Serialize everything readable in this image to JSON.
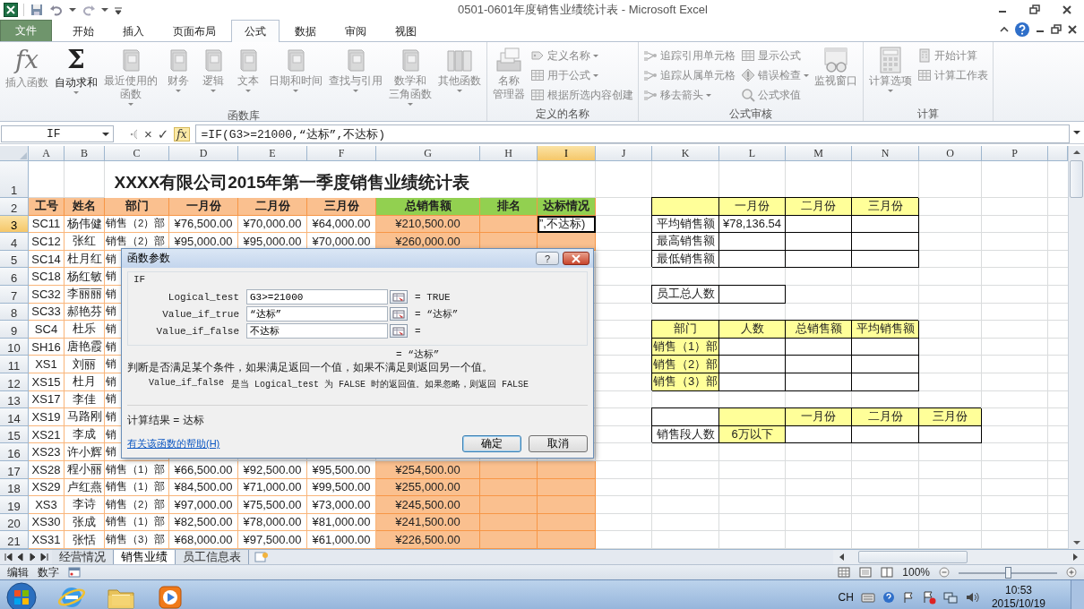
{
  "window": {
    "title": "0501-0601年度销售业绩统计表 - Microsoft Excel"
  },
  "ribbon_tabs": [
    {
      "label": "文件",
      "kind": "file",
      "selected": false
    },
    {
      "label": "开始",
      "kind": "tab",
      "selected": false
    },
    {
      "label": "插入",
      "kind": "tab",
      "selected": false
    },
    {
      "label": "页面布局",
      "kind": "tab",
      "selected": false
    },
    {
      "label": "公式",
      "kind": "tab",
      "selected": true
    },
    {
      "label": "数据",
      "kind": "tab",
      "selected": false
    },
    {
      "label": "审阅",
      "kind": "tab",
      "selected": false
    },
    {
      "label": "视图",
      "kind": "tab",
      "selected": false
    }
  ],
  "ribbon_groups": [
    {
      "label": "函数库",
      "items": [
        {
          "kind": "large",
          "glyph": "fx",
          "label": "插入函数",
          "disabled": true,
          "dropdown": false
        },
        {
          "kind": "large",
          "glyph": "Σ",
          "label": "自动求和",
          "disabled": false,
          "dropdown": true
        },
        {
          "kind": "large",
          "label": [
            "最近使用的",
            "函数"
          ],
          "disabled": true,
          "dropdown": true
        },
        {
          "kind": "large",
          "label": "财务",
          "disabled": true,
          "dropdown": true
        },
        {
          "kind": "large",
          "label": "逻辑",
          "disabled": true,
          "dropdown": true
        },
        {
          "kind": "large",
          "label": "文本",
          "disabled": true,
          "dropdown": true
        },
        {
          "kind": "large",
          "label": "日期和时间",
          "disabled": true,
          "dropdown": true
        },
        {
          "kind": "large",
          "label": "查找与引用",
          "disabled": true,
          "dropdown": true
        },
        {
          "kind": "large",
          "label": [
            "数学和",
            "三角函数"
          ],
          "disabled": true,
          "dropdown": true
        },
        {
          "kind": "large",
          "label": "其他函数",
          "disabled": true,
          "dropdown": true
        }
      ]
    },
    {
      "label": "定义的名称",
      "items": [
        {
          "kind": "large",
          "label": [
            "名称",
            "管理器"
          ],
          "disabled": true,
          "dropdown": false
        },
        {
          "kind": "small",
          "label": "定义名称",
          "disabled": true,
          "dropdown": true
        },
        {
          "kind": "small",
          "label": "用于公式",
          "disabled": true,
          "dropdown": true
        },
        {
          "kind": "small",
          "label": "根据所选内容创建",
          "disabled": true,
          "dropdown": false
        }
      ]
    },
    {
      "label": "公式审核",
      "items": [
        {
          "kind": "small",
          "label": "追踪引用单元格",
          "disabled": true,
          "dropdown": false
        },
        {
          "kind": "small",
          "label": "追踪从属单元格",
          "disabled": true,
          "dropdown": false
        },
        {
          "kind": "small",
          "label": "移去箭头",
          "disabled": true,
          "dropdown": true
        },
        {
          "kind": "small",
          "label": "显示公式",
          "disabled": true,
          "dropdown": false
        },
        {
          "kind": "small",
          "label": "错误检查",
          "disabled": true,
          "dropdown": true
        },
        {
          "kind": "small",
          "label": "公式求值",
          "disabled": true,
          "dropdown": false
        },
        {
          "kind": "large",
          "label": "监视窗口",
          "disabled": true,
          "dropdown": false
        }
      ]
    },
    {
      "label": "计算",
      "items": [
        {
          "kind": "large",
          "label": "计算选项",
          "disabled": true,
          "dropdown": true
        },
        {
          "kind": "small",
          "label": "开始计算",
          "disabled": true,
          "dropdown": false
        },
        {
          "kind": "small",
          "label": "计算工作表",
          "disabled": true,
          "dropdown": false
        }
      ]
    }
  ],
  "formula_bar": {
    "name_box": "IF",
    "cancel": "×",
    "enter": "✓",
    "insert_function": "fx",
    "formula": "=IF(G3>=21000,“达标”,不达标)"
  },
  "sheet": {
    "columns": [
      {
        "label": "A",
        "selected": false
      },
      {
        "label": "B",
        "selected": false
      },
      {
        "label": "C",
        "selected": false
      },
      {
        "label": "D",
        "selected": false
      },
      {
        "label": "E",
        "selected": false
      },
      {
        "label": "F",
        "selected": false
      },
      {
        "label": "G",
        "selected": false
      },
      {
        "label": "H",
        "selected": false
      },
      {
        "label": "I",
        "selected": true
      },
      {
        "label": "J",
        "selected": false
      },
      {
        "label": "K",
        "selected": false
      },
      {
        "label": "L",
        "selected": false
      },
      {
        "label": "M",
        "selected": false
      },
      {
        "label": "N",
        "selected": false
      },
      {
        "label": "O",
        "selected": false
      },
      {
        "label": "P",
        "selected": false
      }
    ],
    "rows": [
      {
        "label": "1",
        "selected": false,
        "cells": [
          {
            "kind": "blank"
          },
          {
            "kind": "blank"
          },
          {
            "kind": "title",
            "text": "XXXX有限公司2015年第一季度销售业绩统计表"
          }
        ]
      },
      {
        "label": "2",
        "selected": false,
        "cells": [
          {
            "kind": "head",
            "text": "工号"
          },
          {
            "kind": "head",
            "text": "姓名"
          },
          {
            "kind": "head",
            "text": "部门"
          },
          {
            "kind": "head",
            "text": "一月份"
          },
          {
            "kind": "head",
            "text": "二月份"
          },
          {
            "kind": "head",
            "text": "三月份"
          },
          {
            "kind": "head-green",
            "text": "总销售额"
          },
          {
            "kind": "head-green",
            "text": "排名"
          },
          {
            "kind": "head-green",
            "text": "达标情况"
          },
          {
            "kind": "blank"
          },
          {
            "kind": "yellow"
          },
          {
            "kind": "yellow",
            "text": "一月份"
          },
          {
            "kind": "yellow",
            "text": "二月份"
          },
          {
            "kind": "yellow",
            "text": "三月份"
          }
        ]
      },
      {
        "label": "3",
        "selected": true,
        "cells": [
          {
            "kind": "data",
            "text": "SC11"
          },
          {
            "kind": "data",
            "text": "杨伟健"
          },
          {
            "kind": "data",
            "text": "销售（2）部"
          },
          {
            "kind": "data",
            "text": "¥76,500.00"
          },
          {
            "kind": "data",
            "text": "¥70,000.00"
          },
          {
            "kind": "data",
            "text": "¥64,000.00"
          },
          {
            "kind": "total",
            "text": "¥210,500.00"
          },
          {
            "kind": "total"
          },
          {
            "kind": "editing",
            "text": "”,不达标)"
          },
          {
            "kind": "blank"
          },
          {
            "kind": "box",
            "text": "平均销售额"
          },
          {
            "kind": "box",
            "text": "¥78,136.54"
          },
          {
            "kind": "box"
          },
          {
            "kind": "box"
          }
        ]
      },
      {
        "label": "4",
        "selected": false,
        "cells": [
          {
            "kind": "data",
            "text": "SC12"
          },
          {
            "kind": "data",
            "text": "张红"
          },
          {
            "kind": "data",
            "text": "销售（2）部"
          },
          {
            "kind": "data",
            "text": "¥95,000.00"
          },
          {
            "kind": "data",
            "text": "¥95,000.00"
          },
          {
            "kind": "data",
            "text": "¥70,000.00"
          },
          {
            "kind": "total",
            "text": "¥260,000.00"
          },
          {
            "kind": "total"
          },
          {
            "kind": "total"
          },
          {
            "kind": "blank"
          },
          {
            "kind": "box",
            "text": "最高销售额"
          },
          {
            "kind": "box"
          },
          {
            "kind": "box"
          },
          {
            "kind": "box"
          }
        ]
      },
      {
        "label": "5",
        "selected": false,
        "cells": [
          {
            "kind": "data",
            "text": "SC14"
          },
          {
            "kind": "data",
            "text": "杜月红"
          },
          {
            "kind": "data",
            "text": "销"
          },
          {
            "kind": "blank"
          },
          {
            "kind": "blank"
          },
          {
            "kind": "blank"
          },
          {
            "kind": "blank"
          },
          {
            "kind": "blank"
          },
          {
            "kind": "blank"
          },
          {
            "kind": "blank"
          },
          {
            "kind": "box",
            "text": "最低销售额"
          },
          {
            "kind": "box"
          },
          {
            "kind": "box"
          },
          {
            "kind": "box"
          }
        ]
      },
      {
        "label": "6",
        "selected": false,
        "cells": [
          {
            "kind": "data",
            "text": "SC18"
          },
          {
            "kind": "data",
            "text": "杨红敏"
          },
          {
            "kind": "data",
            "text": "销"
          }
        ]
      },
      {
        "label": "7",
        "selected": false,
        "cells": [
          {
            "kind": "data",
            "text": "SC32"
          },
          {
            "kind": "data",
            "text": "李丽丽"
          },
          {
            "kind": "data",
            "text": "销"
          },
          {
            "kind": "blank"
          },
          {
            "kind": "blank"
          },
          {
            "kind": "blank"
          },
          {
            "kind": "blank"
          },
          {
            "kind": "blank"
          },
          {
            "kind": "blank"
          },
          {
            "kind": "blank"
          },
          {
            "kind": "box",
            "text": "员工总人数"
          },
          {
            "kind": "box"
          }
        ]
      },
      {
        "label": "8",
        "selected": false,
        "cells": [
          {
            "kind": "data",
            "text": "SC33"
          },
          {
            "kind": "data",
            "text": "郝艳芬"
          },
          {
            "kind": "data",
            "text": "销"
          }
        ]
      },
      {
        "label": "9",
        "selected": false,
        "cells": [
          {
            "kind": "data",
            "text": "SC4"
          },
          {
            "kind": "data",
            "text": "杜乐"
          },
          {
            "kind": "data",
            "text": "销"
          },
          {
            "kind": "blank"
          },
          {
            "kind": "blank"
          },
          {
            "kind": "blank"
          },
          {
            "kind": "blank"
          },
          {
            "kind": "blank"
          },
          {
            "kind": "blank"
          },
          {
            "kind": "blank"
          },
          {
            "kind": "yellow",
            "text": "部门"
          },
          {
            "kind": "yellow",
            "text": "人数"
          },
          {
            "kind": "yellow",
            "text": "总销售额"
          },
          {
            "kind": "yellow",
            "text": "平均销售额"
          }
        ]
      },
      {
        "label": "10",
        "selected": false,
        "cells": [
          {
            "kind": "data",
            "text": "SH16"
          },
          {
            "kind": "data",
            "text": "唐艳霞"
          },
          {
            "kind": "data",
            "text": "销"
          },
          {
            "kind": "blank"
          },
          {
            "kind": "blank"
          },
          {
            "kind": "blank"
          },
          {
            "kind": "blank"
          },
          {
            "kind": "blank"
          },
          {
            "kind": "blank"
          },
          {
            "kind": "blank"
          },
          {
            "kind": "yellow",
            "text": "销售（1）部"
          },
          {
            "kind": "box"
          },
          {
            "kind": "box"
          },
          {
            "kind": "box"
          }
        ]
      },
      {
        "label": "11",
        "selected": false,
        "cells": [
          {
            "kind": "data",
            "text": "XS1"
          },
          {
            "kind": "data",
            "text": "刘丽"
          },
          {
            "kind": "data",
            "text": "销"
          },
          {
            "kind": "blank"
          },
          {
            "kind": "blank"
          },
          {
            "kind": "blank"
          },
          {
            "kind": "blank"
          },
          {
            "kind": "blank"
          },
          {
            "kind": "blank"
          },
          {
            "kind": "blank"
          },
          {
            "kind": "yellow",
            "text": "销售（2）部"
          },
          {
            "kind": "box"
          },
          {
            "kind": "box"
          },
          {
            "kind": "box"
          }
        ]
      },
      {
        "label": "12",
        "selected": false,
        "cells": [
          {
            "kind": "data",
            "text": "XS15"
          },
          {
            "kind": "data",
            "text": "杜月"
          },
          {
            "kind": "data",
            "text": "销"
          },
          {
            "kind": "blank"
          },
          {
            "kind": "blank"
          },
          {
            "kind": "blank"
          },
          {
            "kind": "blank"
          },
          {
            "kind": "blank"
          },
          {
            "kind": "blank"
          },
          {
            "kind": "blank"
          },
          {
            "kind": "yellow",
            "text": "销售（3）部"
          },
          {
            "kind": "box"
          },
          {
            "kind": "box"
          },
          {
            "kind": "box"
          }
        ]
      },
      {
        "label": "13",
        "selected": false,
        "cells": [
          {
            "kind": "data",
            "text": "XS17"
          },
          {
            "kind": "data",
            "text": "李佳"
          },
          {
            "kind": "data",
            "text": "销"
          }
        ]
      },
      {
        "label": "14",
        "selected": false,
        "cells": [
          {
            "kind": "data",
            "text": "XS19"
          },
          {
            "kind": "data",
            "text": "马路刚"
          },
          {
            "kind": "data",
            "text": "销"
          },
          {
            "kind": "blank"
          },
          {
            "kind": "blank"
          },
          {
            "kind": "blank"
          },
          {
            "kind": "blank"
          },
          {
            "kind": "blank"
          },
          {
            "kind": "blank"
          },
          {
            "kind": "blank"
          },
          {
            "kind": "box"
          },
          {
            "kind": "yellow"
          },
          {
            "kind": "yellow",
            "text": "一月份"
          },
          {
            "kind": "yellow",
            "text": "二月份"
          },
          {
            "kind": "yellow",
            "text": "三月份"
          }
        ]
      },
      {
        "label": "15",
        "selected": false,
        "cells": [
          {
            "kind": "data",
            "text": "XS21"
          },
          {
            "kind": "data",
            "text": "李成"
          },
          {
            "kind": "data",
            "text": "销"
          },
          {
            "kind": "blank"
          },
          {
            "kind": "blank"
          },
          {
            "kind": "blank"
          },
          {
            "kind": "blank"
          },
          {
            "kind": "blank"
          },
          {
            "kind": "blank"
          },
          {
            "kind": "blank"
          },
          {
            "kind": "box",
            "text": "销售段人数"
          },
          {
            "kind": "yellow",
            "text": "6万以下"
          },
          {
            "kind": "box"
          },
          {
            "kind": "box"
          },
          {
            "kind": "box"
          }
        ]
      },
      {
        "label": "16",
        "selected": false,
        "cells": [
          {
            "kind": "data",
            "text": "XS23"
          },
          {
            "kind": "data",
            "text": "许小辉"
          },
          {
            "kind": "data",
            "text": "销"
          }
        ]
      },
      {
        "label": "17",
        "selected": false,
        "cells": [
          {
            "kind": "data",
            "text": "XS28"
          },
          {
            "kind": "data",
            "text": "程小丽"
          },
          {
            "kind": "data",
            "text": "销售（1）部"
          },
          {
            "kind": "data",
            "text": "¥66,500.00"
          },
          {
            "kind": "data",
            "text": "¥92,500.00"
          },
          {
            "kind": "data",
            "text": "¥95,500.00"
          },
          {
            "kind": "total",
            "text": "¥254,500.00"
          },
          {
            "kind": "total"
          },
          {
            "kind": "total"
          }
        ]
      },
      {
        "label": "18",
        "selected": false,
        "cells": [
          {
            "kind": "data",
            "text": "XS29"
          },
          {
            "kind": "data",
            "text": "卢红燕"
          },
          {
            "kind": "data",
            "text": "销售（1）部"
          },
          {
            "kind": "data",
            "text": "¥84,500.00"
          },
          {
            "kind": "data",
            "text": "¥71,000.00"
          },
          {
            "kind": "data",
            "text": "¥99,500.00"
          },
          {
            "kind": "total",
            "text": "¥255,000.00"
          },
          {
            "kind": "total"
          },
          {
            "kind": "total"
          }
        ]
      },
      {
        "label": "19",
        "selected": false,
        "cells": [
          {
            "kind": "data",
            "text": "XS3"
          },
          {
            "kind": "data",
            "text": "李诗"
          },
          {
            "kind": "data",
            "text": "销售（2）部"
          },
          {
            "kind": "data",
            "text": "¥97,000.00"
          },
          {
            "kind": "data",
            "text": "¥75,500.00"
          },
          {
            "kind": "data",
            "text": "¥73,000.00"
          },
          {
            "kind": "total",
            "text": "¥245,500.00"
          },
          {
            "kind": "total"
          },
          {
            "kind": "total"
          }
        ]
      },
      {
        "label": "20",
        "selected": false,
        "cells": [
          {
            "kind": "data",
            "text": "XS30"
          },
          {
            "kind": "data",
            "text": "张成"
          },
          {
            "kind": "data",
            "text": "销售（1）部"
          },
          {
            "kind": "data",
            "text": "¥82,500.00"
          },
          {
            "kind": "data",
            "text": "¥78,000.00"
          },
          {
            "kind": "data",
            "text": "¥81,000.00"
          },
          {
            "kind": "total",
            "text": "¥241,500.00"
          },
          {
            "kind": "total"
          },
          {
            "kind": "total"
          }
        ]
      },
      {
        "label": "21",
        "selected": false,
        "cells": [
          {
            "kind": "data",
            "text": "XS31"
          },
          {
            "kind": "data",
            "text": "张恬"
          },
          {
            "kind": "data",
            "text": "销售（3）部"
          },
          {
            "kind": "data",
            "text": "¥68,000.00"
          },
          {
            "kind": "data",
            "text": "¥97,500.00"
          },
          {
            "kind": "data",
            "text": "¥61,000.00"
          },
          {
            "kind": "total",
            "text": "¥226,500.00"
          },
          {
            "kind": "total"
          },
          {
            "kind": "total"
          }
        ]
      }
    ]
  },
  "dialog": {
    "title": "函数参数",
    "help": "?",
    "function": "IF",
    "arguments": [
      {
        "label": "Logical_test",
        "value": "G3>=21000",
        "result": "= TRUE"
      },
      {
        "label": "Value_if_true",
        "value": "“达标”",
        "result": "= “达标”"
      },
      {
        "label": "Value_if_false",
        "value": "不达标",
        "result": "="
      }
    ],
    "formula_result": "= “达标”",
    "description": "判断是否满足某个条件，如果满足返回一个值，如果不满足则返回另一个值。",
    "argument_name": "Value_if_false",
    "argument_help": "是当 Logical_test 为 FALSE 时的返回值。如果忽略，则返回 FALSE",
    "result": "计算结果 = 达标",
    "help_link": "有关该函数的帮助(H)",
    "buttons": [
      {
        "label": "确定",
        "default": true
      },
      {
        "label": "取消",
        "default": false
      }
    ]
  },
  "sheet_tabs": [
    {
      "label": "经营情况",
      "selected": false
    },
    {
      "label": "销售业绩",
      "selected": true
    },
    {
      "label": "员工信息表",
      "selected": false
    }
  ],
  "status_bar": {
    "mode": "编辑",
    "number_format": "数字",
    "zoom": "100%",
    "zoom_slider": {
      "level": 0.5
    }
  },
  "taskbar": {
    "language": "CH",
    "time": "10:53",
    "date": "2015/10/19"
  }
}
